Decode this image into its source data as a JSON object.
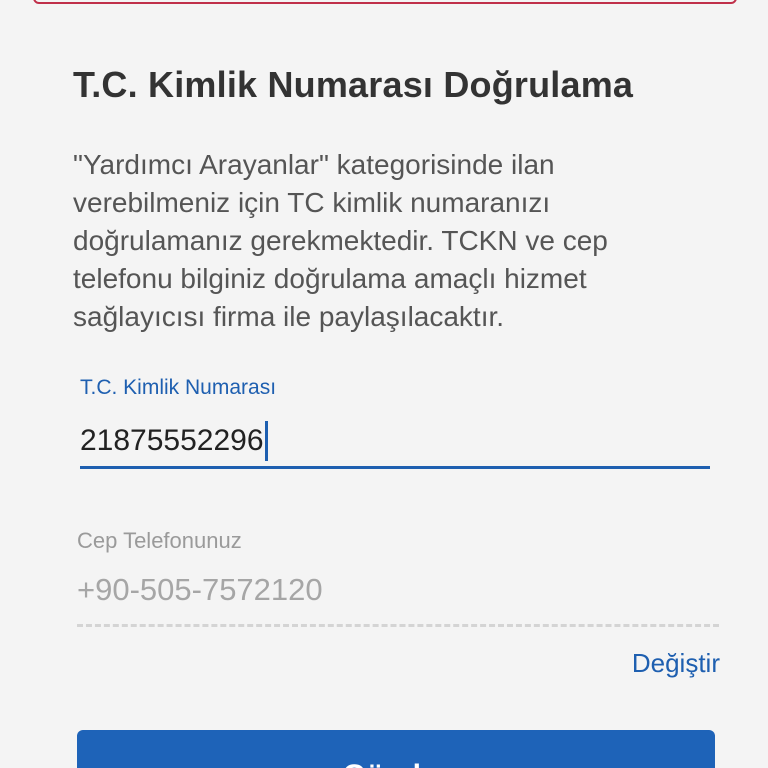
{
  "heading": {
    "title": "T.C. Kimlik Numarası Doğrulama",
    "description": "\"Yardımcı Arayanlar\" kategorisinde ilan verebilmeniz için TC kimlik numaranızı doğrulamanız gerekmektedir. TCKN ve cep telefonu bilginiz doğrulama amaçlı hizmet sağlayıcısı firma ile paylaşılacaktır."
  },
  "tc_field": {
    "label": "T.C. Kimlik Numarası",
    "value": "21875552296"
  },
  "phone_field": {
    "label": "Cep Telefonunuz",
    "value": "+90-505-7572120",
    "change_label": "Değiştir"
  },
  "submit": {
    "label": "Gönder"
  },
  "colors": {
    "accent": "#1e5fb0",
    "button": "#1e63b8",
    "top_card_border": "#c0304a"
  }
}
